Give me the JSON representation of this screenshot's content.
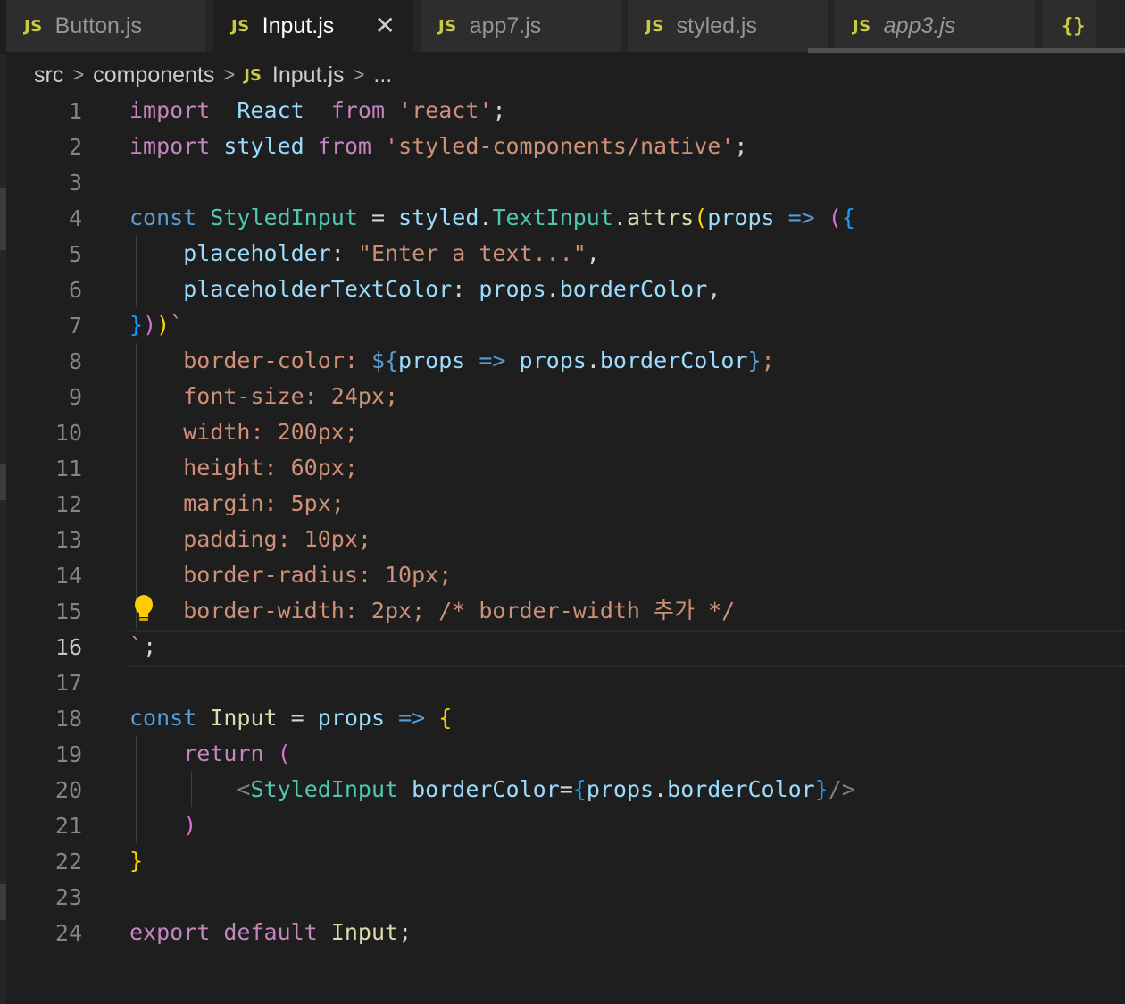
{
  "tabs": [
    {
      "icon": "JS",
      "label": "Button.js",
      "active": false,
      "italic": false
    },
    {
      "icon": "JS",
      "label": "Input.js",
      "active": true,
      "italic": false
    },
    {
      "icon": "JS",
      "label": "app7.js",
      "active": false,
      "italic": false
    },
    {
      "icon": "JS",
      "label": "styled.js",
      "active": false,
      "italic": false
    },
    {
      "icon": "JS",
      "label": "app3.js",
      "active": false,
      "italic": true
    }
  ],
  "tab_overflow_icon": "{}",
  "tab_close_glyph": "✕",
  "breadcrumb": {
    "items": [
      "src",
      "components",
      "Input.js",
      "..."
    ],
    "file_icon": "JS"
  },
  "editor": {
    "current_line": 16,
    "lightbulb_line": 15,
    "line_numbers": [
      "1",
      "2",
      "3",
      "4",
      "5",
      "6",
      "7",
      "8",
      "9",
      "10",
      "11",
      "12",
      "13",
      "14",
      "15",
      "16",
      "17",
      "18",
      "19",
      "20",
      "21",
      "22",
      "23",
      "24"
    ],
    "lines": [
      [
        [
          "kw",
          "import"
        ],
        [
          "",
          "  "
        ],
        [
          "va",
          "React"
        ],
        [
          "",
          "  "
        ],
        [
          "kw",
          "from"
        ],
        [
          "",
          " "
        ],
        [
          "st",
          "'react'"
        ],
        [
          "",
          ";"
        ]
      ],
      [
        [
          "kw",
          "import"
        ],
        [
          "",
          " "
        ],
        [
          "va",
          "styled"
        ],
        [
          "",
          " "
        ],
        [
          "kw",
          "from"
        ],
        [
          "",
          " "
        ],
        [
          "st",
          "'styled-components/native'"
        ],
        [
          "",
          ";"
        ]
      ],
      [],
      [
        [
          "dc",
          "const"
        ],
        [
          "",
          " "
        ],
        [
          "cl",
          "StyledInput"
        ],
        [
          "",
          " = "
        ],
        [
          "va",
          "styled"
        ],
        [
          "",
          "."
        ],
        [
          "cl",
          "TextInput"
        ],
        [
          "",
          "."
        ],
        [
          "fn",
          "attrs"
        ],
        [
          "y",
          "("
        ],
        [
          "va",
          "props"
        ],
        [
          "",
          " "
        ],
        [
          "dc",
          "=>"
        ],
        [
          "",
          " "
        ],
        [
          "m",
          "("
        ],
        [
          "b",
          "{"
        ]
      ],
      [
        [
          "",
          "    "
        ],
        [
          "va",
          "placeholder"
        ],
        [
          "",
          ": "
        ],
        [
          "st",
          "\"Enter a text...\""
        ],
        [
          "",
          ","
        ]
      ],
      [
        [
          "",
          "    "
        ],
        [
          "va",
          "placeholderTextColor"
        ],
        [
          "",
          ": "
        ],
        [
          "va",
          "props"
        ],
        [
          "",
          "."
        ],
        [
          "va",
          "borderColor"
        ],
        [
          "",
          ","
        ]
      ],
      [
        [
          "b",
          "}"
        ],
        [
          "m",
          ")"
        ],
        [
          "y",
          ")"
        ],
        [
          "st",
          "`"
        ]
      ],
      [
        [
          "",
          "    "
        ],
        [
          "cs",
          "border-color: "
        ],
        [
          "dc",
          "${"
        ],
        [
          "va",
          "props"
        ],
        [
          "",
          " "
        ],
        [
          "dc",
          "=>"
        ],
        [
          "",
          " "
        ],
        [
          "va",
          "props"
        ],
        [
          "",
          "."
        ],
        [
          "va",
          "borderColor"
        ],
        [
          "dc",
          "}"
        ],
        [
          "cs",
          ";"
        ]
      ],
      [
        [
          "",
          "    "
        ],
        [
          "cs",
          "font-size: 24px;"
        ]
      ],
      [
        [
          "",
          "    "
        ],
        [
          "cs",
          "width: 200px;"
        ]
      ],
      [
        [
          "",
          "    "
        ],
        [
          "cs",
          "height: 60px;"
        ]
      ],
      [
        [
          "",
          "    "
        ],
        [
          "cs",
          "margin: 5px;"
        ]
      ],
      [
        [
          "",
          "    "
        ],
        [
          "cs",
          "padding: 10px;"
        ]
      ],
      [
        [
          "",
          "    "
        ],
        [
          "cs",
          "border-radius: 10px;"
        ]
      ],
      [
        [
          "",
          "    "
        ],
        [
          "cs",
          "border-width: 2px; "
        ],
        [
          "cc",
          "/* border-width 추가 */"
        ]
      ],
      [
        [
          "st",
          "`"
        ],
        [
          "",
          ";"
        ]
      ],
      [],
      [
        [
          "dc",
          "const"
        ],
        [
          "",
          " "
        ],
        [
          "fn",
          "Input"
        ],
        [
          "",
          " = "
        ],
        [
          "va",
          "props"
        ],
        [
          "",
          " "
        ],
        [
          "dc",
          "=>"
        ],
        [
          "",
          " "
        ],
        [
          "y",
          "{"
        ]
      ],
      [
        [
          "",
          "    "
        ],
        [
          "kw",
          "return"
        ],
        [
          "",
          " "
        ],
        [
          "m",
          "("
        ]
      ],
      [
        [
          "",
          "        "
        ],
        [
          "tg",
          "<"
        ],
        [
          "cl",
          "StyledInput"
        ],
        [
          "",
          " "
        ],
        [
          "va",
          "borderColor"
        ],
        [
          "",
          "="
        ],
        [
          "b",
          "{"
        ],
        [
          "va",
          "props"
        ],
        [
          "",
          "."
        ],
        [
          "va",
          "borderColor"
        ],
        [
          "b",
          "}"
        ],
        [
          "tg",
          "/>"
        ]
      ],
      [
        [
          "",
          "    "
        ],
        [
          "m",
          ")"
        ]
      ],
      [
        [
          "y",
          "}"
        ]
      ],
      [],
      [
        [
          "kw",
          "export"
        ],
        [
          "",
          " "
        ],
        [
          "kw",
          "default"
        ],
        [
          "",
          " "
        ],
        [
          "fn",
          "Input"
        ],
        [
          "",
          ";"
        ]
      ]
    ]
  }
}
